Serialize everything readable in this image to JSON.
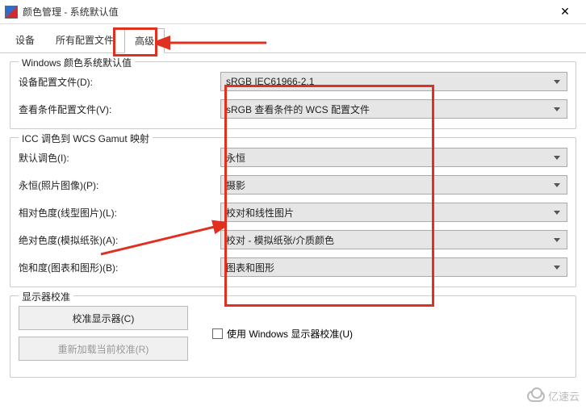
{
  "window": {
    "title": "颜色管理 - 系统默认值",
    "close": "✕"
  },
  "tabs": {
    "devices": "设备",
    "all_profiles": "所有配置文件",
    "advanced": "高级"
  },
  "section_defaults": {
    "legend": "Windows 颜色系统默认值",
    "device_profile_label": "设备配置文件(D):",
    "device_profile_value": "sRGB IEC61966-2.1",
    "view_cond_label": "查看条件配置文件(V):",
    "view_cond_value": "sRGB 查看条件的 WCS 配置文件"
  },
  "section_gamut": {
    "legend": "ICC 调色到 WCS Gamut 映射",
    "default_label": "默认调色(I):",
    "default_value": "永恒",
    "perceptual_label": "永恒(照片图像)(P):",
    "perceptual_value": "摄影",
    "rel_label": "相对色度(线型图片)(L):",
    "rel_value": "校对和线性图片",
    "abs_label": "绝对色度(模拟纸张)(A):",
    "abs_value": "校对 - 模拟纸张/介质颜色",
    "sat_label": "饱和度(图表和图形)(B):",
    "sat_value": "图表和图形"
  },
  "section_calib": {
    "legend": "显示器校准",
    "calibrate_btn": "校准显示器(C)",
    "reload_btn": "重新加载当前校准(R)",
    "use_windows_label": "使用 Windows 显示器校准(U)"
  },
  "watermark": "亿速云"
}
